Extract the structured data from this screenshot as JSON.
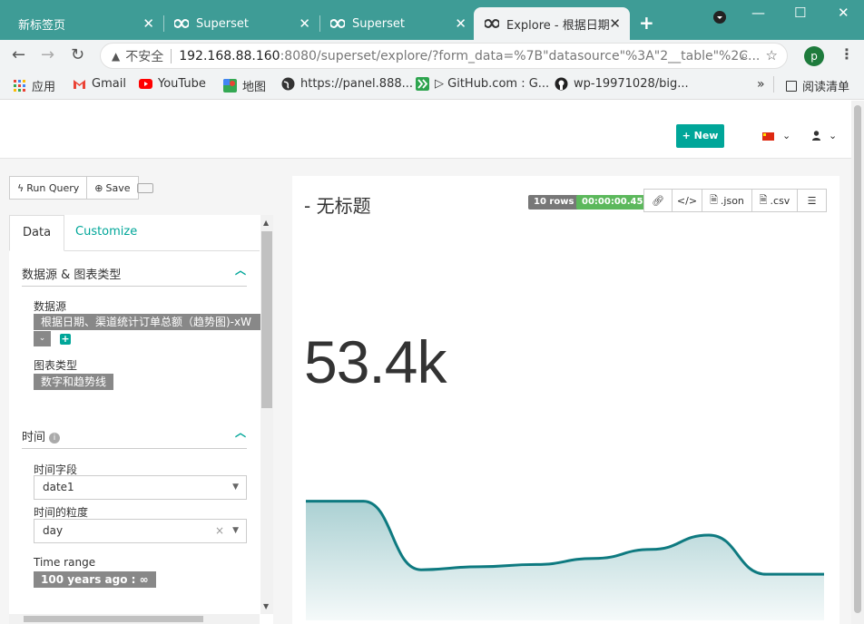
{
  "browser": {
    "tabs": [
      {
        "title": "新标签页"
      },
      {
        "title": "Superset"
      },
      {
        "title": "Superset"
      },
      {
        "title": "Explore - 根据日期"
      }
    ],
    "new_tab": "+",
    "address": {
      "insecure_label": "不安全",
      "host": "192.168.88.160",
      "rest": ":8080/superset/explore/?form_data=%7B\"datasource\"%3A\"2__table\"%2C..."
    },
    "profile_initial": "p",
    "bookmarks": [
      {
        "label": "应用",
        "icon": "apps-grid-icon"
      },
      {
        "label": "Gmail",
        "icon": "gmail-icon"
      },
      {
        "label": "YouTube",
        "icon": "youtube-icon"
      },
      {
        "label": "地图",
        "icon": "maps-icon"
      },
      {
        "label": "https://panel.888...",
        "icon": "globe-icon"
      },
      {
        "label": "▷ GitHub.com : G...",
        "icon": "forward-icon"
      },
      {
        "label": "wp-19971028/big...",
        "icon": "github-icon"
      }
    ],
    "more": "»",
    "reading_list": "阅读清单"
  },
  "navbar": {
    "new_button": "+ New"
  },
  "toolbar": {
    "run_query": "Run Query",
    "save": "Save"
  },
  "left_panel": {
    "tabs": {
      "data": "Data",
      "customize": "Customize"
    },
    "section_datasource": {
      "title": "数据源 & 图表类型",
      "datasource_label": "数据源",
      "datasource_value": "根据日期、渠道统计订单总额（趋势图)-xW",
      "chart_type_label": "图表类型",
      "chart_type_value": "数字和趋势线"
    },
    "section_time": {
      "title": "时间",
      "time_column_label": "时间字段",
      "time_column_value": "date1",
      "time_grain_label": "时间的粒度",
      "time_grain_value": "day",
      "time_range_label": "Time range",
      "time_range_value": "100 years ago : ∞"
    }
  },
  "chart": {
    "title": "- 无标题",
    "rows_badge": "10 rows",
    "timer_badge": "00:00:00.45",
    "actions": {
      "json": ".json",
      "csv": ".csv"
    },
    "big_number": "53.4k",
    "line_color": "#0e7a80"
  },
  "chart_data": {
    "type": "area",
    "title": "- 无标题",
    "big_number": "53.4k",
    "series": [
      {
        "values": [
          0.98,
          0.98,
          0.07,
          0.11,
          0.14,
          0.22,
          0.34,
          0.53,
          0.01,
          0.01
        ]
      }
    ],
    "x": [
      1,
      2,
      3,
      4,
      5,
      6,
      7,
      8,
      9,
      10
    ],
    "ylim": [
      0,
      1
    ],
    "grid": false
  }
}
